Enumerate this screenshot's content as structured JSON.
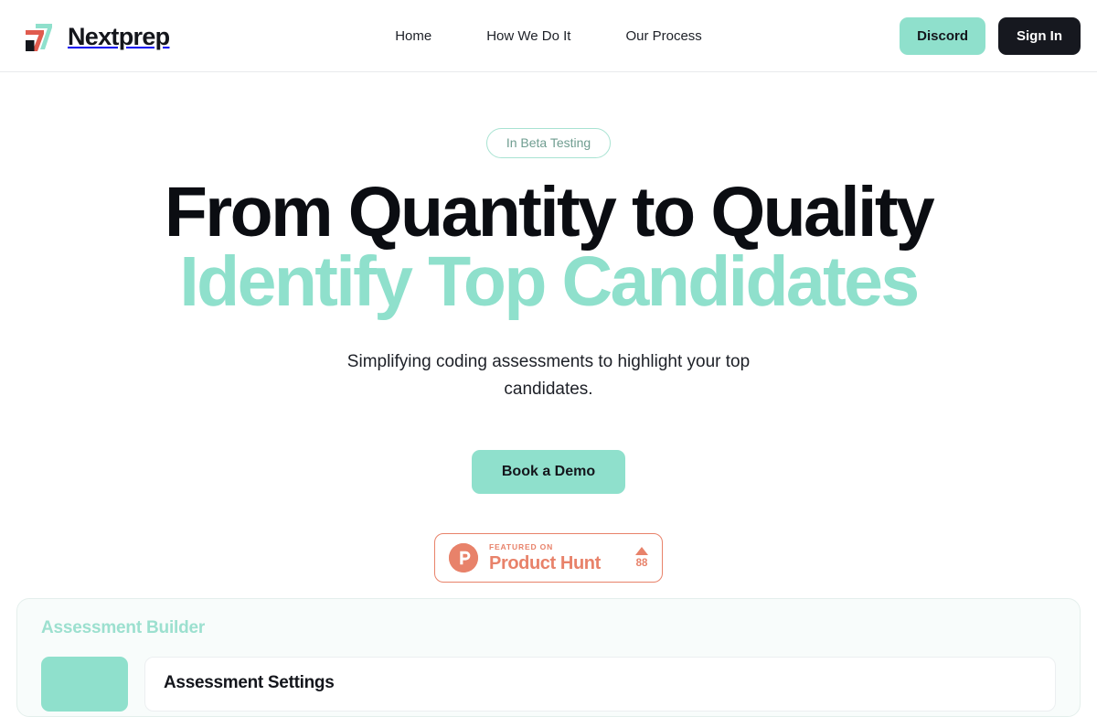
{
  "header": {
    "brand": {
      "name": "Nextprep",
      "logo_colors": {
        "mint": "#8FE0CC",
        "coral": "#E05B4E",
        "navy": "#14161C"
      }
    },
    "nav": [
      {
        "label": "Home"
      },
      {
        "label": "How We Do It"
      },
      {
        "label": "Our Process"
      }
    ],
    "actions": {
      "discord_label": "Discord",
      "signin_label": "Sign In"
    }
  },
  "hero": {
    "badge": "In Beta Testing",
    "headline_line1": "From Quantity to Quality",
    "headline_line2": "Identify Top Candidates",
    "subtitle": "Simplifying coding assessments to highlight your top candidates.",
    "cta_label": "Book a Demo",
    "product_hunt": {
      "featured_on": "FEATURED ON",
      "name": "Product Hunt",
      "logo_letter": "P",
      "upvotes": "88",
      "color": "#E8826A"
    }
  },
  "builder": {
    "title": "Assessment Builder",
    "settings_card_title": "Assessment Settings"
  },
  "theme": {
    "mint": "#8FE0CC",
    "dark": "#16181F",
    "coral": "#E8826A",
    "panel_bg": "#F8FCFB"
  }
}
